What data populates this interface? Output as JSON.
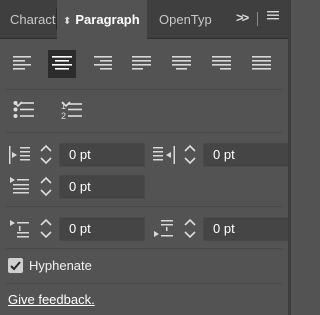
{
  "tabs": [
    {
      "label": "Characte"
    },
    {
      "label": "Paragraph",
      "active": true
    },
    {
      "label": "OpenTyp"
    }
  ],
  "tabbar": {
    "overflow_icon": "double-chevron-right-icon",
    "menu_icon": "hamburger-menu-icon"
  },
  "alignment": {
    "buttons": [
      {
        "name": "align-left",
        "icon": "align-left-icon"
      },
      {
        "name": "align-center",
        "icon": "align-center-icon",
        "selected": true
      },
      {
        "name": "align-right",
        "icon": "align-right-icon"
      },
      {
        "name": "justify-last-left",
        "icon": "justify-last-left-icon"
      },
      {
        "name": "justify-last-center",
        "icon": "justify-last-center-icon"
      },
      {
        "name": "justify-last-right",
        "icon": "justify-last-right-icon"
      },
      {
        "name": "justify-all",
        "icon": "justify-all-icon"
      }
    ]
  },
  "lists": {
    "bullets_icon": "bulleted-list-icon",
    "numbered_icon": "numbered-list-icon"
  },
  "indents": {
    "left_indent": "0 pt",
    "right_indent": "0 pt",
    "first_line_indent": "0 pt"
  },
  "spacing": {
    "space_before": "0 pt",
    "space_after": "0 pt"
  },
  "hyphenate": {
    "label": "Hyphenate",
    "checked": true
  },
  "feedback": {
    "label": "Give feedback."
  },
  "colors": {
    "panel_bg": "#535353",
    "tab_bar_bg": "#3f3f3f",
    "field_bg": "#454545",
    "selected_bg": "#2c2c2c"
  }
}
